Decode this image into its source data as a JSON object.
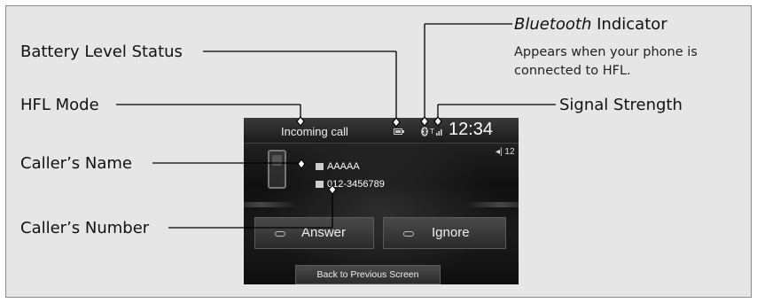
{
  "callouts": {
    "battery_level_status": "Battery Level Status",
    "hfl_mode": "HFL Mode",
    "callers_name": "Caller’s Name",
    "callers_number": "Caller’s Number",
    "bluetooth_word": "Bluetooth",
    "indicator_word": "Indicator",
    "bluetooth_note_line1": "Appears when your phone is",
    "bluetooth_note_line2": "connected to HFL.",
    "signal_strength": "Signal Strength"
  },
  "screen": {
    "mode_text": "Incoming call",
    "clock": "12:34",
    "volume": "◂| 12",
    "caller_name": "AAAAA",
    "caller_number": "012-3456789",
    "answer_label": "Answer",
    "ignore_label": "Ignore",
    "back_label": "Back to Previous Screen"
  },
  "icons": [
    "phone-icon",
    "contact-icon",
    "number-icon",
    "battery-icon",
    "bluetooth-icon",
    "signal-icon",
    "answer-icon",
    "ignore-icon"
  ]
}
